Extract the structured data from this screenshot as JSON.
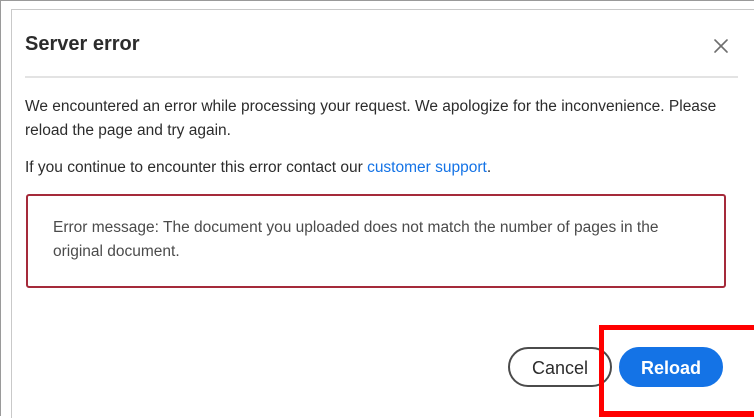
{
  "dialog": {
    "title": "Server error",
    "close_icon": "close-icon",
    "message_line": "We encountered an error while processing your request. We apologize for the inconvenience. Please reload the page and try again.",
    "contact_prefix": "If you continue to encounter this error contact our ",
    "contact_link": "customer support",
    "contact_suffix": ".",
    "error_message": "Error message: The document you uploaded does not match the number of pages in the original document.",
    "cancel_label": "Cancel",
    "reload_label": "Reload"
  },
  "colors": {
    "accent": "#1473e6",
    "error_border": "#a52a3a",
    "highlight": "#ff0000"
  }
}
